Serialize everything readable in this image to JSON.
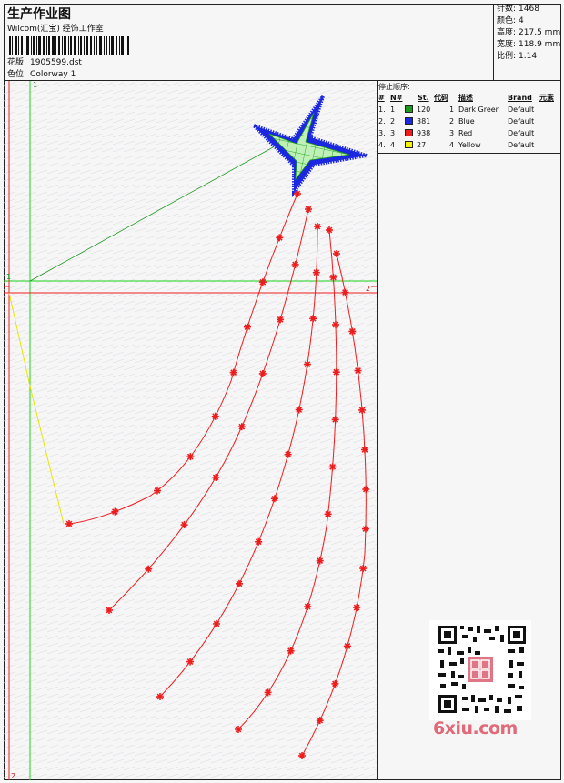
{
  "header": {
    "title": "生产作业图",
    "subtitle": "Wilcom(汇宝) 经饰工作室",
    "design_label": "花版:",
    "design_value": "1905599.dst",
    "color_label": "色位:",
    "color_value": "Colorway 1"
  },
  "stats": [
    {
      "label": "针数:",
      "value": "1468"
    },
    {
      "label": "颜色:",
      "value": "4"
    },
    {
      "label": "高度:",
      "value": "217.5 mm"
    },
    {
      "label": "宽度:",
      "value": "118.9 mm"
    },
    {
      "label": "比例:",
      "value": "1.14"
    }
  ],
  "stop_sequence": {
    "title": "停止顺序:",
    "headers": [
      "#",
      "N#",
      "St.",
      "代码",
      "描述",
      "Brand",
      "元素"
    ],
    "rows": [
      {
        "num": "1.",
        "n": "1",
        "color": "#1b9a1b",
        "stitches": "120",
        "code": "1",
        "desc": "Dark Green",
        "brand": "Default"
      },
      {
        "num": "2.",
        "n": "2",
        "color": "#1c28e0",
        "stitches": "381",
        "code": "2",
        "desc": "Blue",
        "brand": "Default"
      },
      {
        "num": "3.",
        "n": "3",
        "color": "#ee1c1c",
        "stitches": "938",
        "code": "3",
        "desc": "Red",
        "brand": "Default"
      },
      {
        "num": "4.",
        "n": "4",
        "color": "#f5f500",
        "stitches": "27",
        "code": "4",
        "desc": "Yellow",
        "brand": "Default"
      }
    ]
  },
  "guides": {
    "green_top": "1",
    "green_left": "1",
    "red_right": "2",
    "red_bottom": "2"
  },
  "watermark": {
    "text": "6xiu.com"
  },
  "colors": {
    "green": "#1ed41e",
    "red": "#ee1c1c",
    "blue": "#1c28e0",
    "yellow": "#e6e600"
  }
}
